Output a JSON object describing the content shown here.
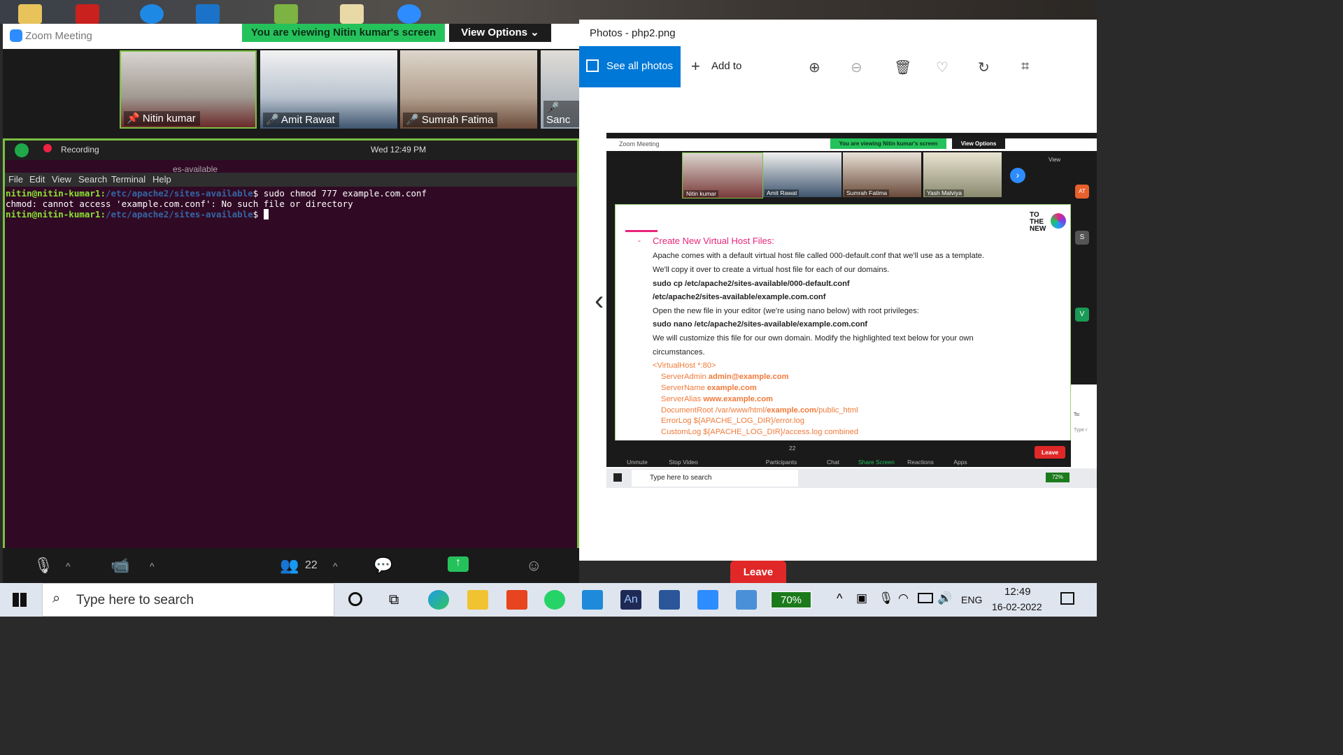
{
  "zoom": {
    "window_title": "Zoom Meeting",
    "viewing_banner": "You are viewing Nitin kumar's screen",
    "view_options": "View Options",
    "participants": [
      "Nitin kumar",
      "Amit Rawat",
      "Sumrah Fatima",
      "Sanc"
    ],
    "recording_label": "Recording",
    "clock": "Wed 12:49 PM",
    "path_crumb": "es-available",
    "terminal_menu": [
      "File",
      "Edit",
      "View",
      "Search",
      "Terminal",
      "Help"
    ],
    "terminal_lines": [
      {
        "user": "nitin@nitin-kumar1:",
        "path": "/etc/apache2/sites-available",
        "cmd": "$ sudo chmod 777 example.com.conf"
      },
      {
        "plain": "chmod: cannot access 'example.com.conf': No such file or directory"
      },
      {
        "user": "nitin@nitin-kumar1:",
        "path": "/etc/apache2/sites-available",
        "cmd": "$ "
      }
    ],
    "participant_count": "22",
    "leave": "Leave"
  },
  "photos": {
    "window_title": "Photos - php2.png",
    "see_all": "See all photos",
    "add_to": "Add to",
    "inner": {
      "title": "Zoom Meeting",
      "banner": "You are viewing Nitin kumar's screen",
      "view_options": "View Options",
      "view_label": "View",
      "participants": [
        "Nitin kumar",
        "Amit Rawat",
        "Sumrah Fatima",
        "Yash Malviya"
      ],
      "side_badges": [
        "AT",
        "S",
        "V"
      ],
      "slide": {
        "logo_lines": [
          "TO",
          "THE",
          "NEW"
        ],
        "heading": "Create New Virtual Host Files:",
        "lines": [
          "Apache comes with a default virtual host file called 000-default.conf that we'll use as a template.",
          "We'll copy it over to create a virtual host file for each of our domains."
        ],
        "cmd1": "sudo cp /etc/apache2/sites-available/000-default.conf",
        "cmd1b": "/etc/apache2/sites-available/example.com.conf",
        "line3": "Open the new file in your editor (we're using nano below) with root privileges:",
        "cmd2": "sudo nano /etc/apache2/sites-available/example.com.conf",
        "line4": "We will customize this file for our own domain. Modify the highlighted text below for your own",
        "line5": "circumstances.",
        "vhost_open": "<VirtualHost *:80>",
        "config": [
          {
            "key": "ServerAdmin ",
            "val": "admin@example.com",
            "rest": ""
          },
          {
            "key": "ServerName ",
            "val": "example.com",
            "rest": ""
          },
          {
            "key": "ServerAlias ",
            "val": "www.example.com",
            "rest": ""
          },
          {
            "key": "DocumentRoot /var/www/html/",
            "val": "example.com",
            "rest": "/public_html"
          },
          {
            "key": "ErrorLog ${APACHE_LOG_DIR}/error.log",
            "val": "",
            "rest": ""
          },
          {
            "key": "CustomLog ${APACHE_LOG_DIR}/access.log combined",
            "val": "",
            "rest": ""
          }
        ]
      },
      "toolbar": [
        "Unmute",
        "Stop Video",
        "Participants",
        "Chat",
        "Share Screen",
        "Reactions",
        "Apps"
      ],
      "participant_count": "22",
      "leave": "Leave",
      "search_placeholder": "Type here to search",
      "battery": "72%",
      "side_text": [
        "To:",
        "Type r"
      ]
    }
  },
  "taskbar": {
    "search_placeholder": "Type here to search",
    "battery": "70%",
    "lang": "ENG",
    "time": "12:49",
    "date": "16-02-2022"
  },
  "colors": {
    "zoom_green": "#25c25c",
    "terminal_bg": "#300a24",
    "photos_blue": "#0078d7",
    "leave_red": "#e02828"
  }
}
